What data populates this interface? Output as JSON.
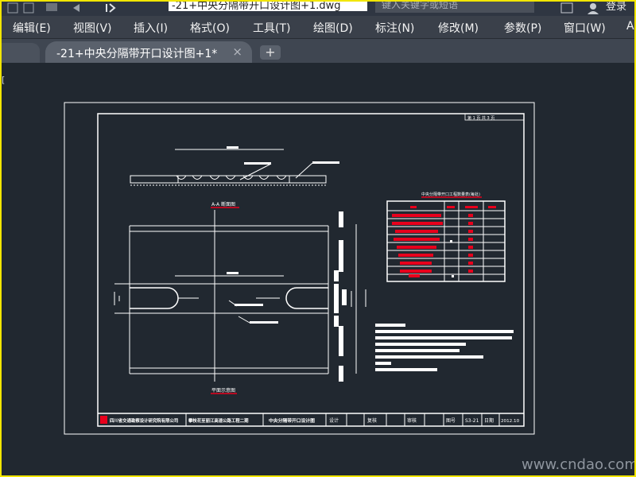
{
  "window": {
    "title": "-21+中央分隔带开口设计图+1.dwg",
    "search_placeholder": "键入关键字或短语",
    "login_label": "登录"
  },
  "menu": {
    "items": [
      {
        "label": "编辑(E)"
      },
      {
        "label": "视图(V)"
      },
      {
        "label": "插入(I)"
      },
      {
        "label": "格式(O)"
      },
      {
        "label": "工具(T)"
      },
      {
        "label": "绘图(D)"
      },
      {
        "label": "标注(N)"
      },
      {
        "label": "修改(M)"
      },
      {
        "label": "参数(P)"
      },
      {
        "label": "窗口(W)"
      },
      {
        "label": "A"
      }
    ]
  },
  "tabs": {
    "active_label": "-21+中央分隔带开口设计图+1*",
    "close_glyph": "×",
    "add_glyph": "+"
  },
  "drawing": {
    "sheet_header": "第 1 页 共 3 页",
    "section_title": "A-A 断面图",
    "plan_title": "平面示意图",
    "table_title": "中央分隔带开口工程数量表(每处)",
    "title_block": {
      "company": "四川省交通勘察设计研究院有限公司",
      "project": "攀枝花至丽江高速公路工程二期",
      "drawing_name": "中央分隔带开口设计图",
      "design": "设计",
      "review": "复核",
      "approve": "审核",
      "drawing_no_label": "图号",
      "drawing_no": "S3-21",
      "date_label": "日期",
      "date": "2012.10"
    },
    "watermark": "www.cndao.com",
    "colors": {
      "background": "#212830",
      "lines": "#ffffff",
      "text_highlight": "#e8001c",
      "frame_accent": "#f2e600"
    }
  }
}
